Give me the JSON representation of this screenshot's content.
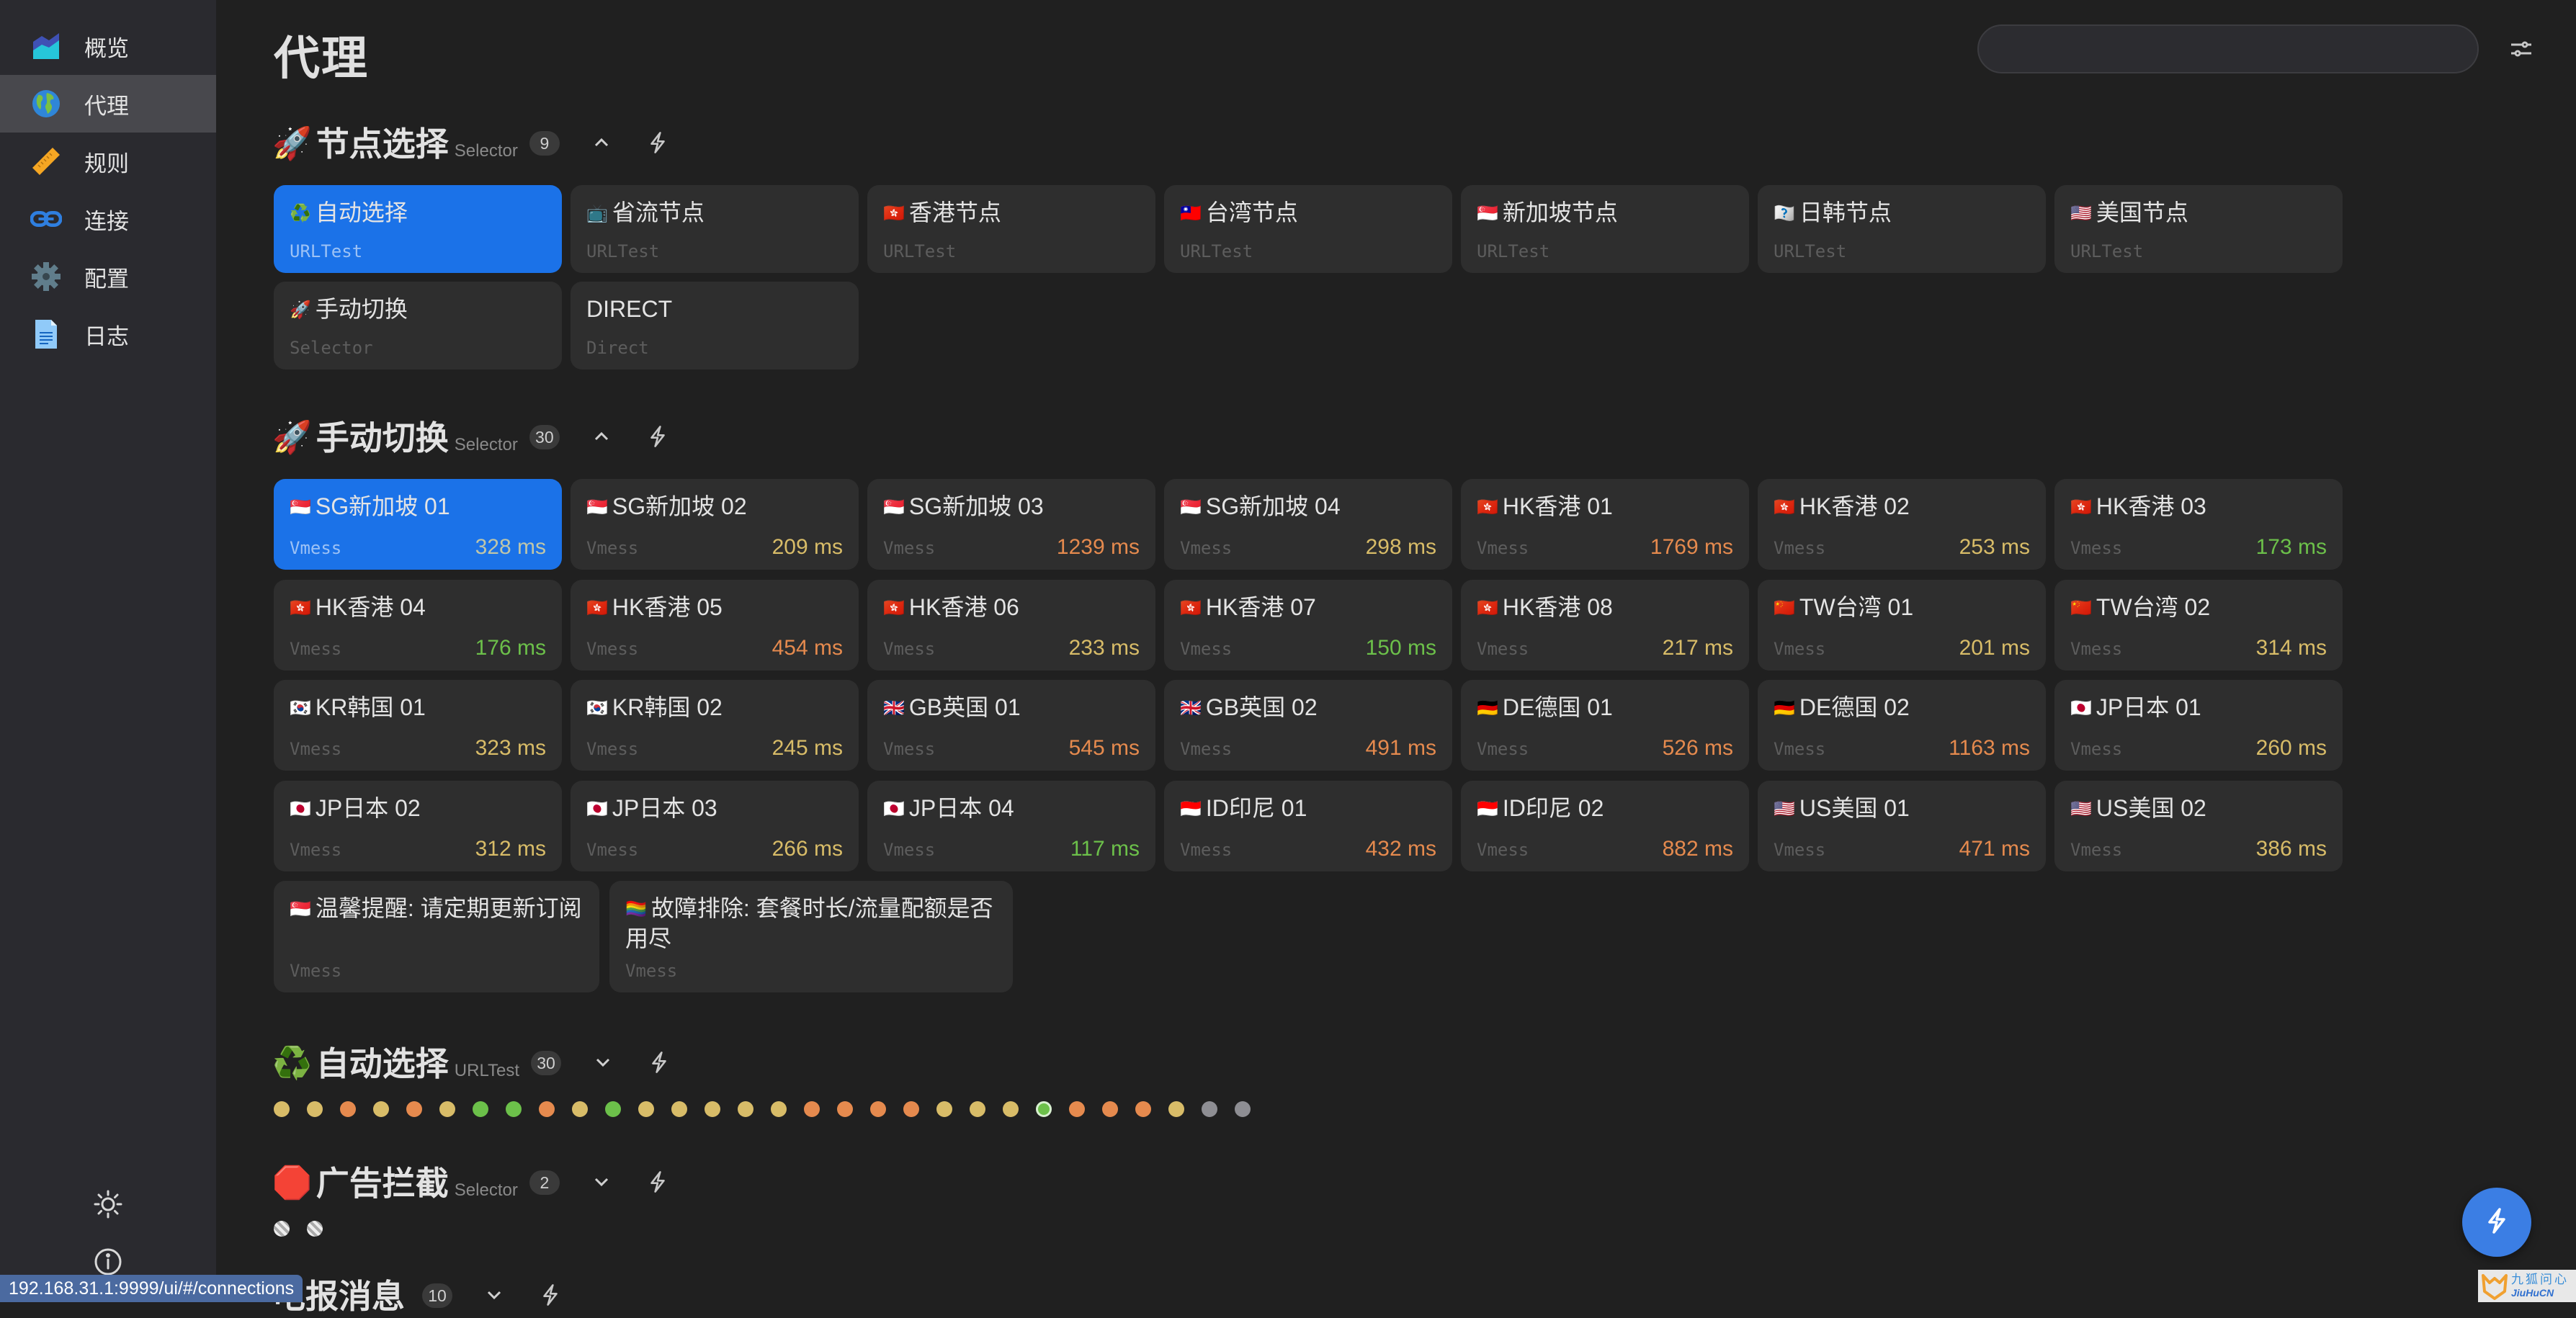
{
  "sidebar": {
    "items": [
      {
        "label": "概览",
        "icon": "chart-area-icon"
      },
      {
        "label": "代理",
        "icon": "globe-icon",
        "active": true
      },
      {
        "label": "规则",
        "icon": "ruler-icon"
      },
      {
        "label": "连接",
        "icon": "link-icon"
      },
      {
        "label": "配置",
        "icon": "gear-icon"
      },
      {
        "label": "日志",
        "icon": "document-icon"
      }
    ],
    "theme_toggle_icon": "sun-icon",
    "about_icon": "info-icon"
  },
  "header": {
    "title": "代理",
    "search_value": "",
    "search_placeholder": "",
    "settings_icon": "sliders-icon"
  },
  "colors": {
    "accent": "#1b72e8",
    "delay_good": "#6cc04a",
    "delay_medium": "#d8bc68",
    "delay_bad": "#e58a4e",
    "delay_none": "#8e8e93"
  },
  "groups": [
    {
      "emoji": "🚀",
      "title": "节点选择",
      "type": "Selector",
      "count": "9",
      "expanded": true,
      "proxies": [
        {
          "flag": "♻️",
          "name": "自动选择",
          "type": "URLTest",
          "selected": true
        },
        {
          "flag": "📺",
          "name": "省流节点",
          "type": "URLTest"
        },
        {
          "flag": "🇭🇰",
          "name": "香港节点",
          "type": "URLTest"
        },
        {
          "flag": "🇹🇼",
          "name": "台湾节点",
          "type": "URLTest"
        },
        {
          "flag": "🇸🇬",
          "name": "新加坡节点",
          "type": "URLTest"
        },
        {
          "flag": "🇯🇰",
          "name": "日韩节点",
          "type": "URLTest"
        },
        {
          "flag": "🇺🇸",
          "name": "美国节点",
          "type": "URLTest"
        },
        {
          "flag": "🚀",
          "name": "手动切换",
          "type": "Selector"
        },
        {
          "flag": "",
          "name": "DIRECT",
          "type": "Direct"
        }
      ]
    },
    {
      "emoji": "🚀",
      "title": "手动切换",
      "type": "Selector",
      "count": "30",
      "expanded": true,
      "proxies": [
        {
          "flag": "🇸🇬",
          "name": "SG新加坡 01",
          "type": "Vmess",
          "delay": "328 ms",
          "level": "medium",
          "selected": true
        },
        {
          "flag": "🇸🇬",
          "name": "SG新加坡 02",
          "type": "Vmess",
          "delay": "209 ms",
          "level": "medium"
        },
        {
          "flag": "🇸🇬",
          "name": "SG新加坡 03",
          "type": "Vmess",
          "delay": "1239 ms",
          "level": "bad"
        },
        {
          "flag": "🇸🇬",
          "name": "SG新加坡 04",
          "type": "Vmess",
          "delay": "298 ms",
          "level": "medium"
        },
        {
          "flag": "🇭🇰",
          "name": "HK香港 01",
          "type": "Vmess",
          "delay": "1769 ms",
          "level": "bad"
        },
        {
          "flag": "🇭🇰",
          "name": "HK香港 02",
          "type": "Vmess",
          "delay": "253 ms",
          "level": "medium"
        },
        {
          "flag": "🇭🇰",
          "name": "HK香港 03",
          "type": "Vmess",
          "delay": "173 ms",
          "level": "good"
        },
        {
          "flag": "🇭🇰",
          "name": "HK香港 04",
          "type": "Vmess",
          "delay": "176 ms",
          "level": "good"
        },
        {
          "flag": "🇭🇰",
          "name": "HK香港 05",
          "type": "Vmess",
          "delay": "454 ms",
          "level": "bad"
        },
        {
          "flag": "🇭🇰",
          "name": "HK香港 06",
          "type": "Vmess",
          "delay": "233 ms",
          "level": "medium"
        },
        {
          "flag": "🇭🇰",
          "name": "HK香港 07",
          "type": "Vmess",
          "delay": "150 ms",
          "level": "good"
        },
        {
          "flag": "🇭🇰",
          "name": "HK香港 08",
          "type": "Vmess",
          "delay": "217 ms",
          "level": "medium"
        },
        {
          "flag": "🇨🇳",
          "name": "TW台湾 01",
          "type": "Vmess",
          "delay": "201 ms",
          "level": "medium"
        },
        {
          "flag": "🇨🇳",
          "name": "TW台湾 02",
          "type": "Vmess",
          "delay": "314 ms",
          "level": "medium"
        },
        {
          "flag": "🇰🇷",
          "name": "KR韩国 01",
          "type": "Vmess",
          "delay": "323 ms",
          "level": "medium"
        },
        {
          "flag": "🇰🇷",
          "name": "KR韩国 02",
          "type": "Vmess",
          "delay": "245 ms",
          "level": "medium"
        },
        {
          "flag": "🇬🇧",
          "name": "GB英国 01",
          "type": "Vmess",
          "delay": "545 ms",
          "level": "bad"
        },
        {
          "flag": "🇬🇧",
          "name": "GB英国 02",
          "type": "Vmess",
          "delay": "491 ms",
          "level": "bad"
        },
        {
          "flag": "🇩🇪",
          "name": "DE德国 01",
          "type": "Vmess",
          "delay": "526 ms",
          "level": "bad"
        },
        {
          "flag": "🇩🇪",
          "name": "DE德国 02",
          "type": "Vmess",
          "delay": "1163 ms",
          "level": "bad"
        },
        {
          "flag": "🇯🇵",
          "name": "JP日本 01",
          "type": "Vmess",
          "delay": "260 ms",
          "level": "medium"
        },
        {
          "flag": "🇯🇵",
          "name": "JP日本 02",
          "type": "Vmess",
          "delay": "312 ms",
          "level": "medium"
        },
        {
          "flag": "🇯🇵",
          "name": "JP日本 03",
          "type": "Vmess",
          "delay": "266 ms",
          "level": "medium"
        },
        {
          "flag": "🇯🇵",
          "name": "JP日本 04",
          "type": "Vmess",
          "delay": "117 ms",
          "level": "good"
        },
        {
          "flag": "🇮🇩",
          "name": "ID印尼 01",
          "type": "Vmess",
          "delay": "432 ms",
          "level": "bad"
        },
        {
          "flag": "🇮🇩",
          "name": "ID印尼 02",
          "type": "Vmess",
          "delay": "882 ms",
          "level": "bad"
        },
        {
          "flag": "🇺🇸",
          "name": "US美国 01",
          "type": "Vmess",
          "delay": "471 ms",
          "level": "bad"
        },
        {
          "flag": "🇺🇸",
          "name": "US美国 02",
          "type": "Vmess",
          "delay": "386 ms",
          "level": "medium"
        },
        {
          "flag": "🇸🇬",
          "name": "温馨提醒: 请定期更新订阅",
          "type": "Vmess",
          "delay": "",
          "level": "none"
        },
        {
          "flag": "🏳️‍🌈",
          "name": "故障排除: 套餐时长/流量配额是否用尽",
          "type": "Vmess",
          "delay": "",
          "level": "none"
        }
      ]
    },
    {
      "emoji": "♻️",
      "title": "自动选择",
      "type": "URLTest",
      "count": "30",
      "expanded": false,
      "dots": [
        "medium",
        "medium",
        "bad",
        "medium",
        "bad",
        "medium",
        "good",
        "good",
        "bad",
        "medium",
        "good",
        "medium",
        "medium",
        "medium",
        "medium",
        "medium",
        "bad",
        "bad",
        "bad",
        "bad",
        "medium",
        "medium",
        "medium",
        "good",
        "bad",
        "bad",
        "bad",
        "medium",
        "none",
        "none"
      ],
      "selected_index": 23
    },
    {
      "emoji": "🛑",
      "title": "广告拦截",
      "type": "Selector",
      "count": "2",
      "expanded": false,
      "dots": [
        "striped",
        "striped"
      ]
    },
    {
      "emoji": "",
      "title": "电报消息",
      "type": "",
      "count": "10",
      "expanded": false
    }
  ],
  "status_url": "192.168.31.1:9999/ui/#/connections",
  "fab_icon": "lightning-icon",
  "watermark": {
    "cn": "九狐问心",
    "en": "JiuHuCN"
  }
}
